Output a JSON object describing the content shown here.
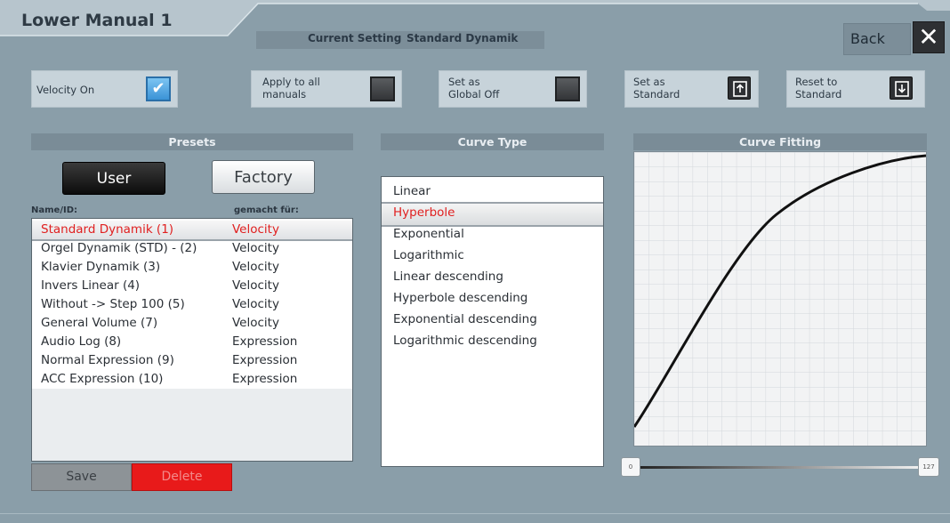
{
  "header": {
    "title": "Lower Manual 1",
    "current_setting_label": "Current Setting",
    "current_setting_value": "Standard Dynamik",
    "back_label": "Back",
    "close_symbol": "✕"
  },
  "options": {
    "velocity_on": {
      "label": "Velocity On",
      "checked": true
    },
    "apply_all": {
      "label": "Apply to all\nmanuals",
      "checked": false
    },
    "global_off": {
      "label": "Set as\nGlobal Off",
      "checked": false
    },
    "set_standard": {
      "label": "Set as\nStandard",
      "icon": "upload-icon"
    },
    "reset_standard": {
      "label": "Reset to\nStandard",
      "icon": "download-icon"
    }
  },
  "presets": {
    "heading": "Presets",
    "user_label": "User",
    "factory_label": "Factory",
    "col_name": "Name/ID:",
    "col_type": "gemacht für:",
    "items": [
      {
        "name": "Standard Dynamik (1)",
        "type": "Velocity",
        "selected": true
      },
      {
        "name": "Orgel Dynamik (STD) - (2)",
        "type": "Velocity"
      },
      {
        "name": "Klavier Dynamik (3)",
        "type": "Velocity"
      },
      {
        "name": "Invers Linear (4)",
        "type": "Velocity"
      },
      {
        "name": "Without -> Step 100 (5)",
        "type": "Velocity"
      },
      {
        "name": "General Volume (7)",
        "type": "Velocity"
      },
      {
        "name": "Audio Log (8)",
        "type": "Expression"
      },
      {
        "name": "Normal Expression (9)",
        "type": "Expression"
      },
      {
        "name": "ACC Expression (10)",
        "type": "Expression"
      }
    ],
    "save_label": "Save",
    "delete_label": "Delete"
  },
  "curve_type": {
    "heading": "Curve Type",
    "items": [
      "Linear",
      "Hyperbole",
      "Exponential",
      "Logarithmic",
      "Linear descending",
      "Hyperbole descending",
      "Exponential descending",
      "Logarithmic descending"
    ],
    "selected_index": 1
  },
  "curve_fitting": {
    "heading": "Curve Fitting",
    "slider_min_label": "0",
    "slider_max_label": "127"
  },
  "colors": {
    "background": "#8a9ea9",
    "selected_text": "#e02020",
    "delete_button": "#e81a1a"
  }
}
